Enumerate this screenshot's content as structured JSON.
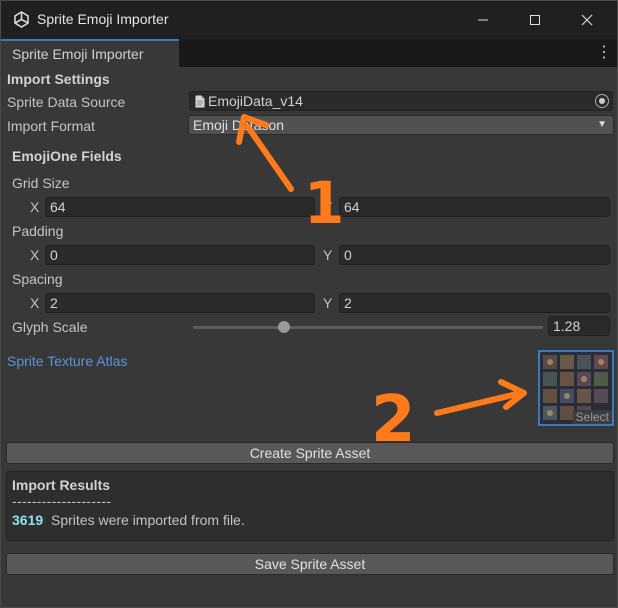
{
  "window": {
    "title": "Sprite Emoji Importer"
  },
  "tab": {
    "label": "Sprite Emoji Importer"
  },
  "import_settings": {
    "header": "Import Settings",
    "sprite_data_source": {
      "label": "Sprite Data Source",
      "value": "EmojiData_v14"
    },
    "import_format": {
      "label": "Import Format",
      "value": "Emoji Datason"
    }
  },
  "emojione_fields": {
    "header": "EmojiOne Fields",
    "grid_size": {
      "label": "Grid Size",
      "x": "64",
      "y": "64"
    },
    "padding": {
      "label": "Padding",
      "x": "0",
      "y": "0"
    },
    "spacing": {
      "label": "Spacing",
      "x": "2",
      "y": "2"
    },
    "axis_x": "X",
    "axis_y": "Y",
    "glyph_scale": {
      "label": "Glyph Scale",
      "value": "1.28",
      "fraction": 0.26
    }
  },
  "atlas": {
    "label": "Sprite Texture Atlas",
    "select_label": "Select"
  },
  "buttons": {
    "create": "Create Sprite Asset",
    "save": "Save Sprite Asset"
  },
  "results": {
    "header": "Import Results",
    "separator": "--------------------",
    "count": "3619",
    "message": "Sprites were imported from file."
  },
  "annotations": {
    "step1": "1",
    "step2": "2",
    "color": "#ff7a1a"
  },
  "colors": {
    "accent": "#3a79bb",
    "link": "#5a94dc",
    "count": "#8fe0f0"
  }
}
